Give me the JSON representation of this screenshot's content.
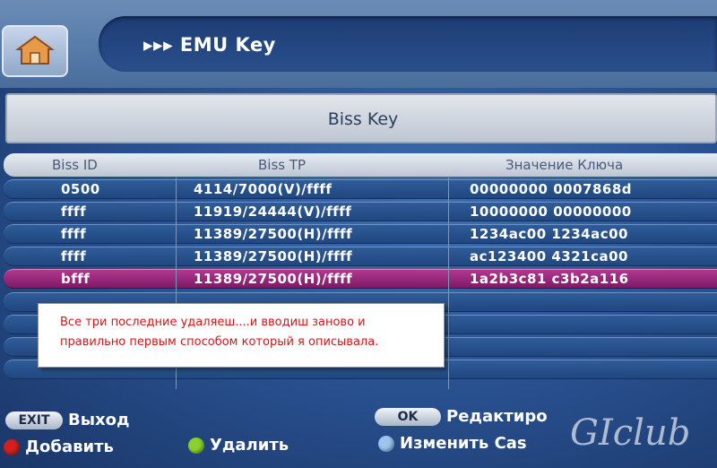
{
  "header": {
    "title": "▸▸▸ EMU Key"
  },
  "section": {
    "title": "Biss Key"
  },
  "columns": {
    "id": "Biss ID",
    "tp": "Biss TP",
    "value": "Значение Ключа"
  },
  "rows": [
    {
      "id": "0500",
      "tp": "4114/7000(V)/ffff",
      "value": "00000000 0007868d",
      "selected": false
    },
    {
      "id": "ffff",
      "tp": "11919/24444(V)/ffff",
      "value": "10000000 00000000",
      "selected": false
    },
    {
      "id": "ffff",
      "tp": "11389/27500(H)/ffff",
      "value": "1234ac00 1234ac00",
      "selected": false
    },
    {
      "id": "ffff",
      "tp": "11389/27500(H)/ffff",
      "value": "ac123400 4321ca00",
      "selected": false
    },
    {
      "id": "bfff",
      "tp": "11389/27500(H)/ffff",
      "value": "1a2b3c81 c3b2a116",
      "selected": true
    }
  ],
  "note": {
    "line1": "Все три последние удаляеш....и вводиш заново и",
    "line2": "правильно первым способом который я описывала."
  },
  "footer": {
    "exit_key": "EXIT",
    "exit_label": "Выход",
    "ok_key": "OK",
    "ok_label": "Редактиро",
    "red_label": "Добавить",
    "green_label": "Удалить",
    "blue_label": "Изменить Cas"
  },
  "watermark": "GIclub",
  "colors": {
    "selected_row": "#9a2a80",
    "row": "#2a5290",
    "note_text": "#d01818",
    "red_dot": "#d02020",
    "green_dot": "#8ad030",
    "blue_dot": "#9cc4ec"
  }
}
